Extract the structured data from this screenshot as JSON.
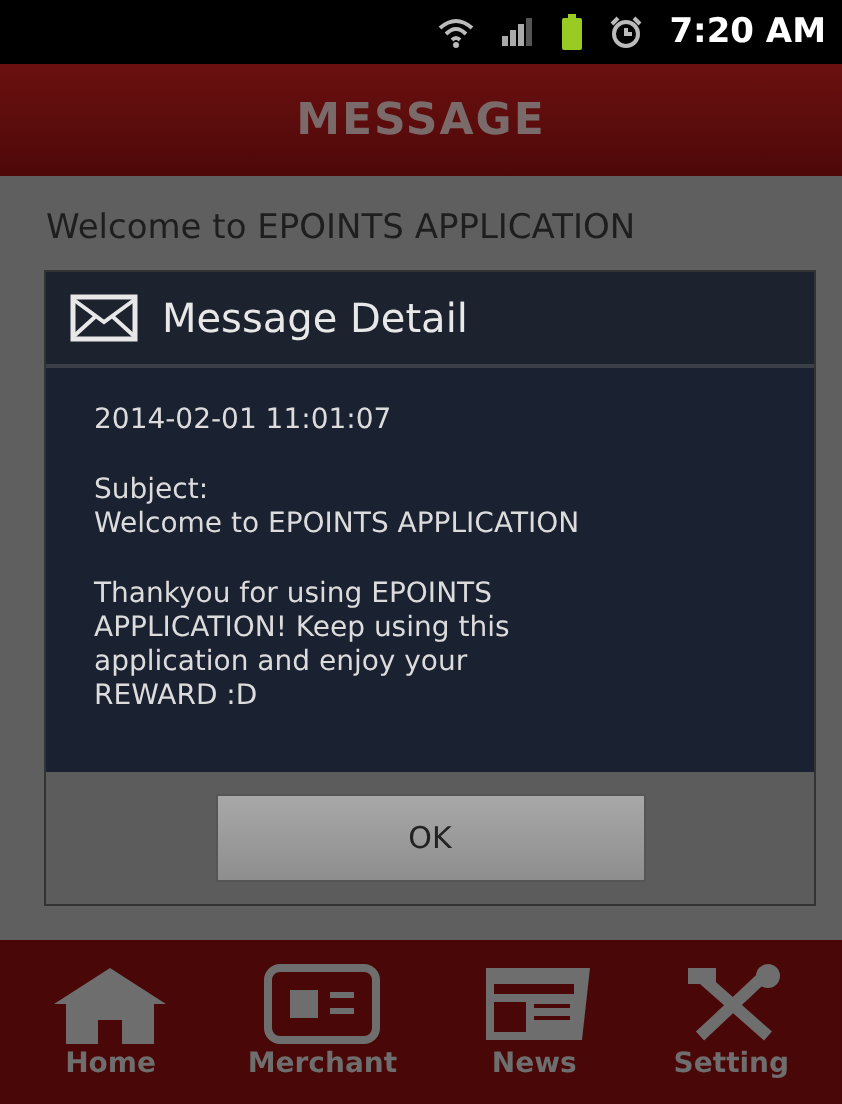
{
  "status_bar": {
    "time": "7:20 AM"
  },
  "header": {
    "title": "MESSAGE"
  },
  "list": {
    "items": [
      "Welcome to EPOINTS APPLICATION"
    ]
  },
  "dialog": {
    "title": "Message Detail",
    "date": "2014-02-01 11:01:07",
    "subject_label": "Subject:",
    "subject": "Welcome to EPOINTS APPLICATION",
    "body": "Thankyou for using EPOINTS APPLICATION! Keep using this application and enjoy your REWARD :D",
    "button": "OK"
  },
  "nav": [
    {
      "kind": "home",
      "label": "Home"
    },
    {
      "kind": "merchant",
      "label": "Merchant"
    },
    {
      "kind": "news",
      "label": "News"
    },
    {
      "kind": "setting",
      "label": "Setting"
    }
  ]
}
